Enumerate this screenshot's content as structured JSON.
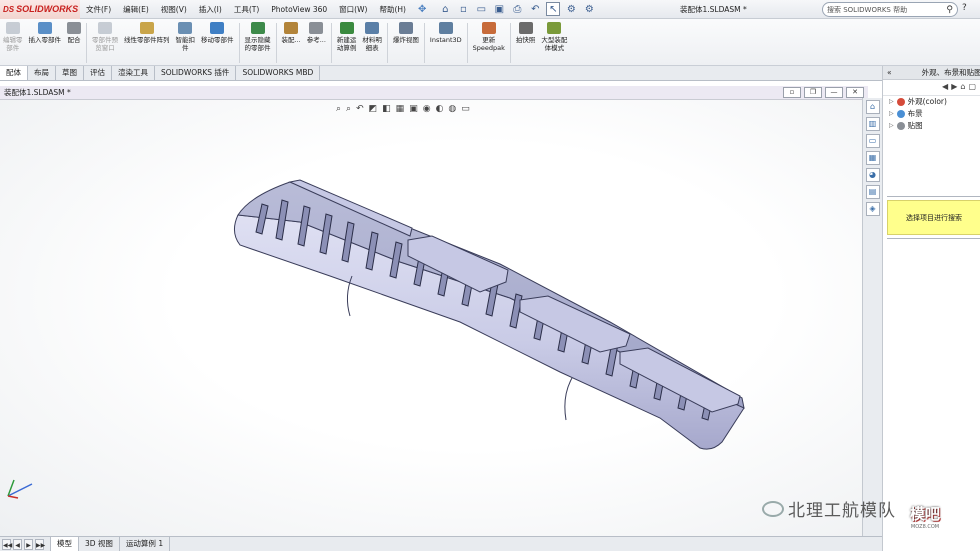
{
  "app": {
    "logo": "SOLIDWORKS",
    "logo_prefix": "DS",
    "document_title": "装配体1.SLDASM *",
    "search_placeholder": "搜索 SOLIDWORKS 帮助",
    "help": "?"
  },
  "menu": [
    "文件(F)",
    "编辑(E)",
    "视图(V)",
    "插入(I)",
    "工具(T)",
    "PhotoView 360",
    "窗口(W)",
    "帮助(H)"
  ],
  "ribbon": [
    {
      "label": "编辑零\n部件",
      "disabled": true,
      "color": "#7d8a9a"
    },
    {
      "label": "插入零部件",
      "disabled": false,
      "color": "#5a8fc7"
    },
    {
      "label": "配合",
      "disabled": false,
      "color": "#8a8f96"
    },
    {
      "label": "零部件预\n览窗口",
      "disabled": true,
      "color": "#7d8a9a"
    },
    {
      "label": "线性零部件阵列",
      "disabled": false,
      "color": "#c9a54a"
    },
    {
      "label": "智能扣\n件",
      "disabled": false,
      "color": "#6a8fb3"
    },
    {
      "label": "移动零部件",
      "disabled": false,
      "color": "#3f7fc4"
    },
    {
      "label": "显示隐藏\n的零部件",
      "disabled": false,
      "color": "#3d8a4a"
    },
    {
      "label": "装配...",
      "disabled": false,
      "color": "#b2843a"
    },
    {
      "label": "参考...",
      "disabled": false,
      "color": "#8a8f96"
    },
    {
      "label": "新建运\n动算例",
      "disabled": false,
      "color": "#3a8a3f"
    },
    {
      "label": "材料明\n细表",
      "disabled": false,
      "color": "#5a7fa7"
    },
    {
      "label": "爆炸视图",
      "disabled": false,
      "color": "#6a7d95"
    },
    {
      "label": "Instant3D",
      "disabled": false,
      "color": "#5f7fa0"
    },
    {
      "label": "更新\nSpeedpak",
      "disabled": false,
      "color": "#c76b3a"
    },
    {
      "label": "拍快照",
      "disabled": false,
      "color": "#6b6b6b"
    },
    {
      "label": "大型装配\n体模式",
      "disabled": false,
      "color": "#7a9a3a"
    }
  ],
  "tabs": [
    "配体",
    "布局",
    "草图",
    "评估",
    "渲染工具",
    "SOLIDWORKS 插件",
    "SOLIDWORKS MBD"
  ],
  "active_tab": 0,
  "document": {
    "title": "装配体1.SLDASM *"
  },
  "task_pane": {
    "header_arrow": "«",
    "title": "外观、布景和贴图",
    "items": [
      {
        "label": "外观(color)",
        "color": "#d54b3a"
      },
      {
        "label": "布景",
        "color": "#4a8fd4"
      },
      {
        "label": "贴图",
        "color": "#8a8f96"
      }
    ],
    "hint": "选择项目进行搜索"
  },
  "bottom_tabs": [
    "模型",
    "3D 视图",
    "运动算例 1"
  ],
  "active_bottom_tab": 0,
  "watermark": {
    "text": "北理工航模队",
    "logo_main": "模吧",
    "logo_sub": "MOZ8.COM"
  }
}
